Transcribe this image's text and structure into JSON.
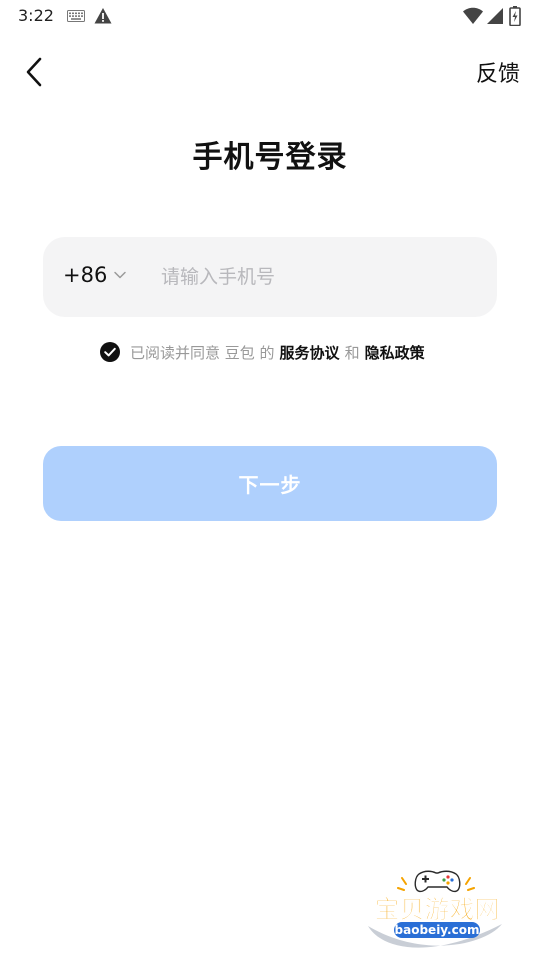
{
  "status_bar": {
    "time": "3:22"
  },
  "header": {
    "feedback_label": "反馈"
  },
  "title": "手机号登录",
  "phone": {
    "country_code": "+86",
    "placeholder": "请输入手机号",
    "value": ""
  },
  "agreement": {
    "prefix": "已阅读并同意 豆包 的",
    "service_link": "服务协议",
    "and": "和",
    "privacy_link": "隐私政策",
    "checked": true
  },
  "next_button": {
    "label": "下一步",
    "enabled": false
  },
  "watermark": {
    "brand": "宝贝游戏网",
    "url": "baobeiy.com"
  },
  "colors": {
    "primary_disabled": "#afd0fd",
    "input_bg": "#f4f4f5",
    "placeholder": "#b8b8bc",
    "muted_text": "#999999",
    "watermark_orange": "#f5a300",
    "watermark_blue": "#2a6fd6"
  }
}
